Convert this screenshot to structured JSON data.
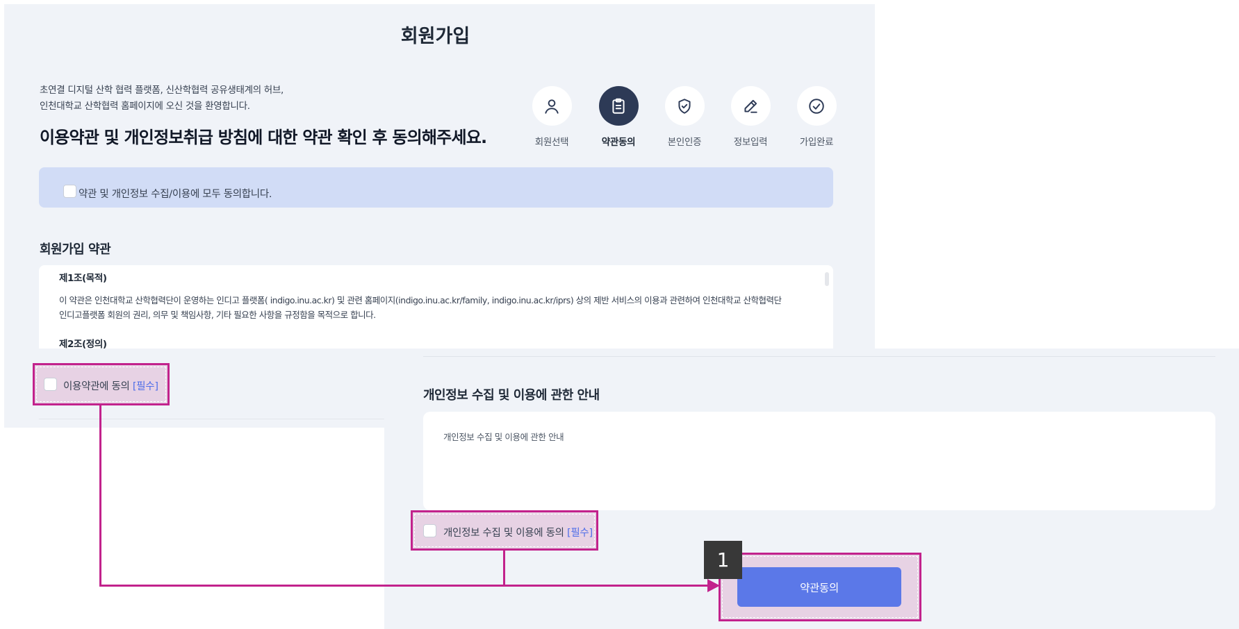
{
  "page_title": "회원가입",
  "intro": {
    "line1": "초연결 디지털 산학 협력 플랫폼, 신산학협력 공유생태계의 허브,",
    "line2": "인천대학교 산학협력 홈페이지에 오신 것을 환영합니다."
  },
  "heading": "이용약관 및 개인정보취급 방침에 대한 약관 확인 후 동의해주세요.",
  "steps": [
    {
      "label": "회원선택",
      "icon": "person-icon"
    },
    {
      "label": "약관동의",
      "icon": "clipboard-icon",
      "active": true
    },
    {
      "label": "본인인증",
      "icon": "shield-check-icon"
    },
    {
      "label": "정보입력",
      "icon": "pencil-icon"
    },
    {
      "label": "가입완료",
      "icon": "check-circle-icon"
    }
  ],
  "agree_all": {
    "label": "약관 및 개인정보 수집/이용에 모두 동의합니다."
  },
  "terms": {
    "title": "회원가입 약관",
    "article1_title": "제1조(목적)",
    "article1_line1": "이 약관은 인천대학교 산학협력단이 운영하는 인디고 플랫폼( indigo.inu.ac.kr) 및 관련 홈페이지(indigo.inu.ac.kr/family, indigo.inu.ac.kr/iprs) 상의 제반 서비스의 이용과 관련하여 인천대학교 산학협력단",
    "article1_line2": "인디고플랫폼 회원의 권리, 의무 및 책임사항, 기타 필요한 사항을 규정함을 목적으로 합니다.",
    "article2_title": "제2조(정의)",
    "agree_label": "이용약관에 동의",
    "required": "[필수]"
  },
  "privacy": {
    "title": "개인정보 수집 및 이용에 관한 안내",
    "content": "개인정보 수집 및 이용에 관한 안내",
    "agree_label": "개인정보 수집 및 이용에 동의",
    "required": "[필수]"
  },
  "button": {
    "label": "약관동의"
  },
  "annotation": {
    "number": "1"
  },
  "colors": {
    "highlight": "#c2228c",
    "button": "#5b78e8",
    "active_step": "#2d3a56",
    "agree_bar": "#d1dcf6"
  }
}
